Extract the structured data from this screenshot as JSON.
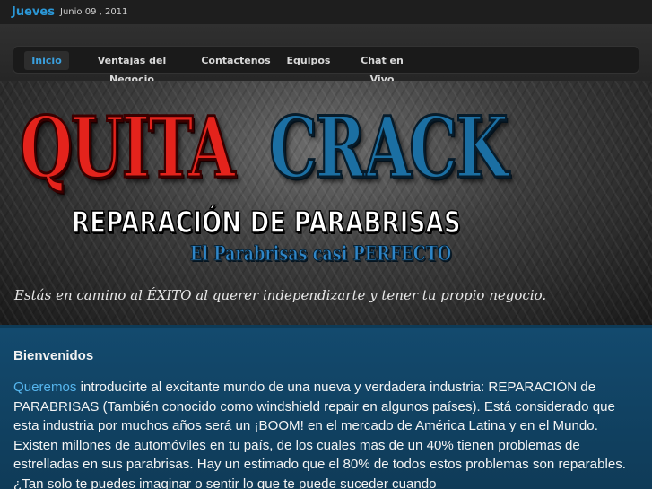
{
  "header": {
    "day": "Jueves",
    "date": "Junio 09 , 2011"
  },
  "nav": {
    "items": [
      {
        "label": "Inicio",
        "active": true
      },
      {
        "label": "Ventajas del Negocio",
        "active": false
      },
      {
        "label": "Contactenos",
        "active": false
      },
      {
        "label": "Equipos",
        "active": false
      },
      {
        "label": "Chat en Vivo",
        "active": false
      }
    ]
  },
  "hero": {
    "logo_red": "QUITA",
    "logo_blue": "CRACK",
    "subtitle": "REPARACIÓN DE PARABRISAS",
    "tagline": "El Parabrisas casi PERFECTO",
    "slogan": "Estás en camino al ÉXITO al querer independizarte y tener tu propio negocio."
  },
  "main": {
    "heading": "Bienvenidos",
    "intro_link": "Queremos",
    "intro_text": " introducirte al excitante mundo de una nueva y verdadera industria: REPARACIÓN de PARABRISAS (También conocido como windshield repair en algunos países). Está considerado que esta industria por muchos años será un ¡BOOM! en el mercado de América Latina y en el Mundo. Existen millones de automóviles en tu país, de los cuales mas de un 40% tienen problemas de estrelladas en sus parabrisas. Hay un estimado que el 80% de todos estos problemas son reparables. ¿Tan solo te puedes imaginar o sentir lo que te puede suceder cuando"
  }
}
